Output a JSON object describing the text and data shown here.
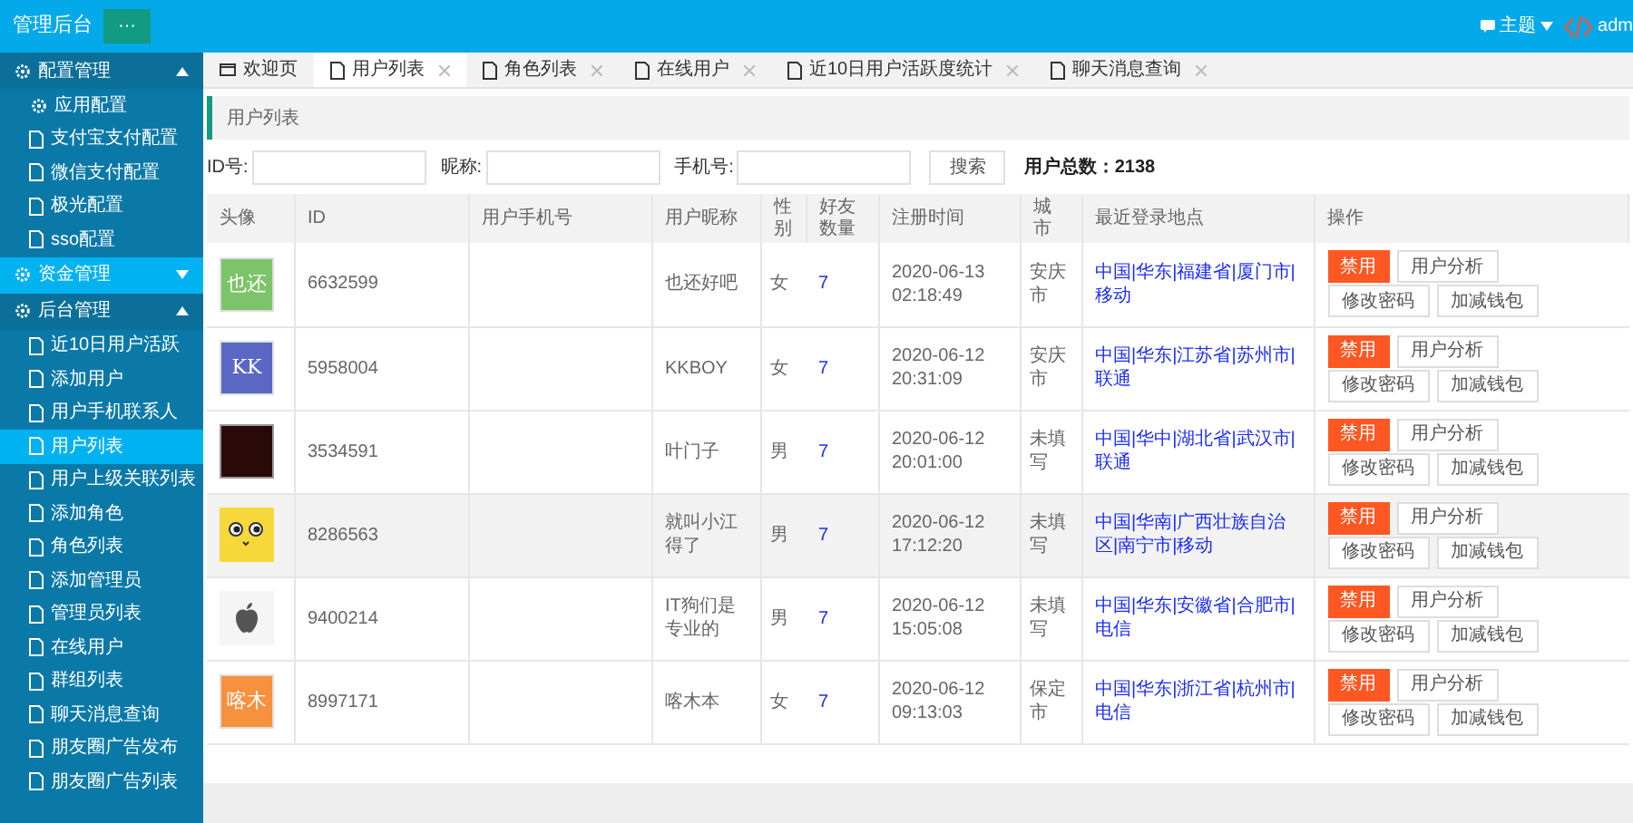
{
  "header": {
    "title": "管理后台",
    "menu_button": "···",
    "theme": "主题",
    "user": "adm"
  },
  "sidebar": {
    "groups": [
      {
        "label": "配置管理",
        "expanded": true,
        "selected": false,
        "children": [
          {
            "label": "应用配置",
            "kind": "gear",
            "selected": false
          },
          {
            "label": "支付宝支付配置",
            "kind": "page",
            "selected": false
          },
          {
            "label": "微信支付配置",
            "kind": "page",
            "selected": false
          },
          {
            "label": "极光配置",
            "kind": "page",
            "selected": false
          },
          {
            "label": "sso配置",
            "kind": "page",
            "selected": false
          }
        ]
      },
      {
        "label": "资金管理",
        "expanded": false,
        "selected": true
      },
      {
        "label": "后台管理",
        "expanded": true,
        "selected": false,
        "children": [
          {
            "label": "近10日用户活跃",
            "kind": "page",
            "selected": false
          },
          {
            "label": "添加用户",
            "kind": "page",
            "selected": false
          },
          {
            "label": "用户手机联系人",
            "kind": "page",
            "selected": false
          },
          {
            "label": "用户列表",
            "kind": "page",
            "selected": true
          },
          {
            "label": "用户上级关联列表",
            "kind": "page",
            "selected": false
          },
          {
            "label": "添加角色",
            "kind": "page",
            "selected": false
          },
          {
            "label": "角色列表",
            "kind": "page",
            "selected": false
          },
          {
            "label": "添加管理员",
            "kind": "page",
            "selected": false
          },
          {
            "label": "管理员列表",
            "kind": "page",
            "selected": false
          },
          {
            "label": "在线用户",
            "kind": "page",
            "selected": false
          },
          {
            "label": "群组列表",
            "kind": "page",
            "selected": false
          },
          {
            "label": "聊天消息查询",
            "kind": "page",
            "selected": false
          },
          {
            "label": "朋友圈广告发布",
            "kind": "page",
            "selected": false
          },
          {
            "label": "朋友圈广告列表",
            "kind": "page",
            "selected": false
          }
        ]
      }
    ]
  },
  "tabs": [
    {
      "label": "欢迎页",
      "kind": "home",
      "selected": false
    },
    {
      "label": "用户列表",
      "kind": "page",
      "selected": true
    },
    {
      "label": "角色列表",
      "kind": "page",
      "selected": false
    },
    {
      "label": "在线用户",
      "kind": "page",
      "selected": false
    },
    {
      "label": "近10日用户活跃度统计",
      "kind": "page",
      "selected": false
    },
    {
      "label": "聊天消息查询",
      "kind": "page",
      "selected": false
    }
  ],
  "breadcrumb": "用户列表",
  "filters": [
    {
      "label": "ID号:"
    },
    {
      "label": "昵称:"
    },
    {
      "label": "手机号:"
    }
  ],
  "search_button": "搜索",
  "total": "用户总数：2138",
  "table": {
    "columns": [
      "头像",
      "ID",
      "用户手机号",
      "用户昵称",
      "性别",
      "好友数量",
      "注册时间",
      "城市",
      "最近登录地点",
      "操作"
    ],
    "rows": [
      {
        "avatar": {
          "kind": "text",
          "text": "也还",
          "color": "#7cc36a"
        },
        "id": "6632599",
        "hovered": false,
        "nickname": "也还好吧",
        "gender": "女",
        "friends": "7",
        "date": "2020-06-13",
        "time": "02:18:49",
        "city": "安庆市",
        "location": "中国|华东|福建省|厦门市|移动",
        "actions": [
          {
            "label": "禁用",
            "kind": "primary"
          },
          {
            "label": "用户分析",
            "kind": "plain"
          },
          {
            "label": "修改密码",
            "kind": "plain"
          },
          {
            "label": "加减钱包",
            "kind": "plain"
          }
        ]
      },
      {
        "avatar": {
          "kind": "text",
          "text": "KK",
          "color": "#5b67c4"
        },
        "id": "5958004",
        "hovered": false,
        "nickname": "KKBOY",
        "gender": "女",
        "friends": "7",
        "date": "2020-06-12",
        "time": "20:31:09",
        "city": "安庆市",
        "location": "中国|华东|江苏省|苏州市|联通",
        "actions": [
          {
            "label": "禁用",
            "kind": "primary"
          },
          {
            "label": "用户分析",
            "kind": "plain"
          },
          {
            "label": "修改密码",
            "kind": "plain"
          },
          {
            "label": "加减钱包",
            "kind": "plain"
          }
        ]
      },
      {
        "avatar": {
          "kind": "photo",
          "color": "#2a0a08"
        },
        "id": "3534591",
        "hovered": false,
        "nickname": "叶门子",
        "gender": "男",
        "friends": "7",
        "date": "2020-06-12",
        "time": "20:01:00",
        "city": "未填写",
        "location": "中国|华中|湖北省|武汉市|联通",
        "actions": [
          {
            "label": "禁用",
            "kind": "primary"
          },
          {
            "label": "用户分析",
            "kind": "plain"
          },
          {
            "label": "修改密码",
            "kind": "plain"
          },
          {
            "label": "加减钱包",
            "kind": "plain"
          }
        ]
      },
      {
        "avatar": {
          "kind": "cat",
          "color": "#f7d83a"
        },
        "id": "8286563",
        "hovered": true,
        "nickname": "就叫小江得了",
        "gender": "男",
        "friends": "7",
        "date": "2020-06-12",
        "time": "17:12:20",
        "city": "未填写",
        "location": "中国|华南|广西壮族自治区|南宁市|移动",
        "actions": [
          {
            "label": "禁用",
            "kind": "primary"
          },
          {
            "label": "用户分析",
            "kind": "plain"
          },
          {
            "label": "修改密码",
            "kind": "plain"
          },
          {
            "label": "加减钱包",
            "kind": "plain"
          }
        ]
      },
      {
        "avatar": {
          "kind": "fruit",
          "color": "#f5f5f5"
        },
        "id": "9400214",
        "hovered": false,
        "nickname": "IT狗们是专业的",
        "gender": "男",
        "friends": "7",
        "date": "2020-06-12",
        "time": "15:05:08",
        "city": "未填写",
        "location": "中国|华东|安徽省|合肥市|电信",
        "actions": [
          {
            "label": "禁用",
            "kind": "primary"
          },
          {
            "label": "用户分析",
            "kind": "plain"
          },
          {
            "label": "修改密码",
            "kind": "plain"
          },
          {
            "label": "加减钱包",
            "kind": "plain"
          }
        ]
      },
      {
        "avatar": {
          "kind": "text",
          "text": "喀木",
          "color": "#f7913d"
        },
        "id": "8997171",
        "hovered": false,
        "nickname": "喀木本",
        "gender": "女",
        "friends": "7",
        "date": "2020-06-12",
        "time": "09:13:03",
        "city": "保定市",
        "location": "中国|华东|浙江省|杭州市|电信",
        "actions": [
          {
            "label": "禁用",
            "kind": "primary"
          },
          {
            "label": "用户分析",
            "kind": "plain"
          },
          {
            "label": "修改密码",
            "kind": "plain"
          },
          {
            "label": "加减钱包",
            "kind": "plain"
          }
        ]
      }
    ]
  }
}
